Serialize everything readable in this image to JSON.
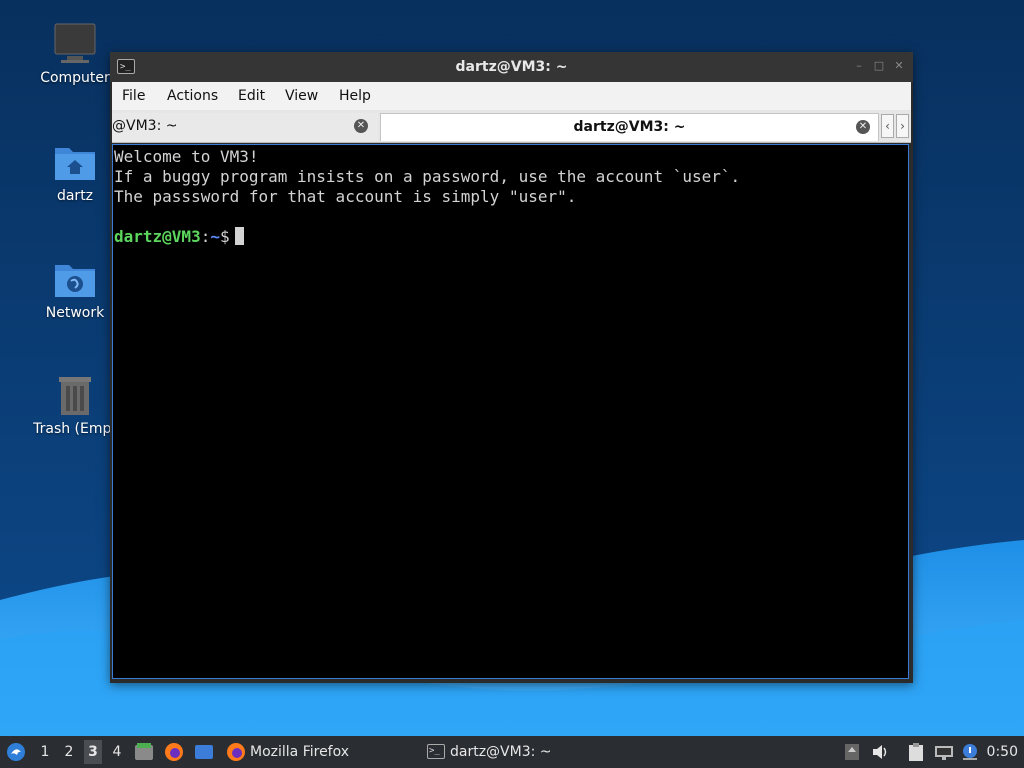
{
  "desktop": {
    "icons": [
      {
        "label": "Computer",
        "icon": "computer-icon"
      },
      {
        "label": "dartz",
        "icon": "home-folder-icon"
      },
      {
        "label": "Network",
        "icon": "network-folder-icon"
      },
      {
        "label": "Trash (Empt",
        "icon": "trash-icon"
      }
    ]
  },
  "window": {
    "title": "dartz@VM3: ~",
    "menu": [
      "File",
      "Actions",
      "Edit",
      "View",
      "Help"
    ],
    "tabs": [
      {
        "label": "@VM3: ~",
        "active": false
      },
      {
        "label": "dartz@VM3: ~",
        "active": true
      }
    ],
    "terminal": {
      "lines": [
        "Welcome to VM3!",
        "If a buggy program insists on a password, use the account `user`.",
        "The passsword for that account is simply \"user\"."
      ],
      "prompt_user": "dartz@VM3",
      "prompt_sep": ":",
      "prompt_dir": "~",
      "prompt_symbol": "$"
    }
  },
  "taskbar": {
    "workspaces": [
      "1",
      "2",
      "3",
      "4"
    ],
    "active_workspace": "3",
    "tasks": [
      {
        "label": "Mozilla Firefox",
        "icon": "firefox-icon"
      },
      {
        "label": "dartz@VM3: ~",
        "icon": "terminal-icon"
      }
    ],
    "clock": "0:50"
  },
  "colors": {
    "desktop_bg": "#0b3d73",
    "accent": "#3a7bd5",
    "prompt_user": "#5cd65c",
    "prompt_dir": "#5a8cff"
  }
}
